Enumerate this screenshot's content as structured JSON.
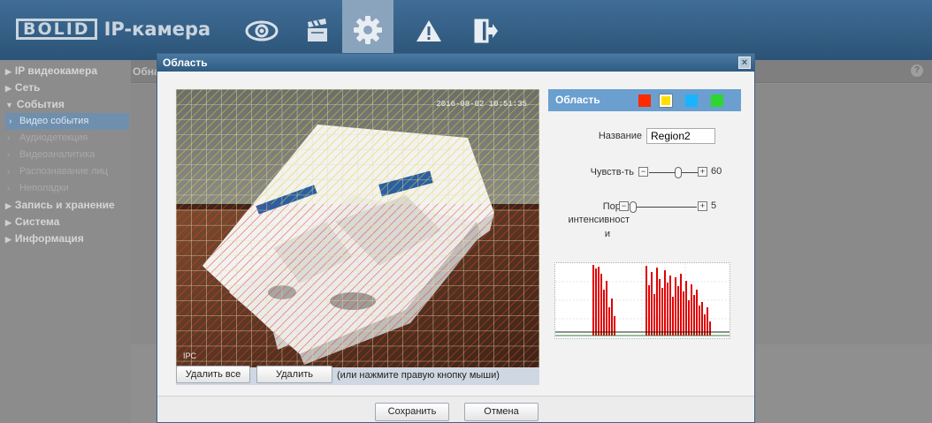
{
  "header": {
    "logo": "BOLID",
    "product": "IP-камера",
    "nav": [
      {
        "icon": "eye-icon",
        "active": false
      },
      {
        "icon": "clapperboard-icon",
        "active": false
      },
      {
        "icon": "gear-icon",
        "active": true
      },
      {
        "icon": "warning-icon",
        "active": false
      },
      {
        "icon": "logout-icon",
        "active": false
      }
    ]
  },
  "sidebar": {
    "items": [
      {
        "label": "IP видеокамера",
        "expanded": false
      },
      {
        "label": "Сеть",
        "expanded": false
      },
      {
        "label": "События",
        "expanded": true
      },
      {
        "label": "Запись и хранение",
        "expanded": false
      },
      {
        "label": "Система",
        "expanded": false
      },
      {
        "label": "Информация",
        "expanded": false
      }
    ],
    "events_sub": [
      {
        "label": "Видео события",
        "active": true
      },
      {
        "label": "Аудиодетекция",
        "active": false
      },
      {
        "label": "Видеоаналитика",
        "active": false
      },
      {
        "label": "Распознавание лиц",
        "active": false
      },
      {
        "label": "Неполадки",
        "active": false
      }
    ]
  },
  "content": {
    "head_label": "Обна"
  },
  "modal": {
    "title": "Область",
    "close": "×",
    "video": {
      "timestamp": "2016-08-02 10:51:35",
      "channel": "IPC"
    },
    "buttons": {
      "delete_all": "Удалить все",
      "delete": "Удалить",
      "hint": "(или нажмите правую кнопку мыши)",
      "save": "Сохранить",
      "cancel": "Отмена"
    },
    "panel": {
      "title": "Область",
      "swatches": [
        {
          "color": "#ff2a00",
          "selected": false
        },
        {
          "color": "#ffe000",
          "selected": true
        },
        {
          "color": "#19b4ff",
          "selected": false
        },
        {
          "color": "#2ed62e",
          "selected": false
        }
      ],
      "name_label": "Название",
      "name_value": "Region2",
      "sensitivity_label": "Чувств-ть",
      "sensitivity_value": "60",
      "sensitivity_level": 0.6,
      "threshold_label_1": "Порог",
      "threshold_label_2": "интенсивност",
      "threshold_label_3": "и",
      "threshold_value": "5",
      "threshold_level": 0.05
    }
  }
}
